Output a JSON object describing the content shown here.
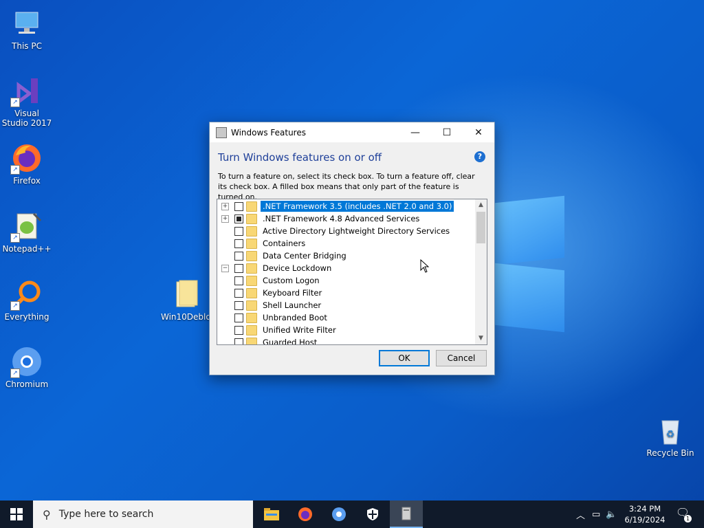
{
  "desktop": {
    "icons": [
      {
        "label": "This PC",
        "icon": "computer-icon"
      },
      {
        "label": "Visual Studio 2017",
        "icon": "visual-studio-icon"
      },
      {
        "label": "Firefox",
        "icon": "firefox-icon"
      },
      {
        "label": "Notepad++",
        "icon": "notepadpp-icon"
      },
      {
        "label": "Everything",
        "icon": "everything-search-icon"
      },
      {
        "label": "Chromium",
        "icon": "chromium-icon"
      },
      {
        "label": "Win10Deblo...",
        "icon": "folder-icon"
      },
      {
        "label": "Recycle Bin",
        "icon": "recycle-bin-icon"
      }
    ]
  },
  "dialog": {
    "title": "Windows Features",
    "heading": "Turn Windows features on or off",
    "description": "To turn a feature on, select its check box. To turn a feature off, clear its check box. A filled box means that only part of the feature is turned on.",
    "features": [
      {
        "label": ".NET Framework 3.5 (includes .NET 2.0 and 3.0)",
        "state": "unchecked",
        "expander": "+",
        "level": 0,
        "selected": true
      },
      {
        "label": ".NET Framework 4.8 Advanced Services",
        "state": "partial",
        "expander": "+",
        "level": 0,
        "selected": false
      },
      {
        "label": "Active Directory Lightweight Directory Services",
        "state": "unchecked",
        "expander": "",
        "level": 0,
        "selected": false
      },
      {
        "label": "Containers",
        "state": "unchecked",
        "expander": "",
        "level": 0,
        "selected": false
      },
      {
        "label": "Data Center Bridging",
        "state": "unchecked",
        "expander": "",
        "level": 0,
        "selected": false
      },
      {
        "label": "Device Lockdown",
        "state": "unchecked",
        "expander": "−",
        "level": 0,
        "selected": false
      },
      {
        "label": "Custom Logon",
        "state": "unchecked",
        "expander": "",
        "level": 1,
        "selected": false
      },
      {
        "label": "Keyboard Filter",
        "state": "unchecked",
        "expander": "",
        "level": 1,
        "selected": false
      },
      {
        "label": "Shell Launcher",
        "state": "unchecked",
        "expander": "",
        "level": 1,
        "selected": false
      },
      {
        "label": "Unbranded Boot",
        "state": "unchecked",
        "expander": "",
        "level": 1,
        "selected": false
      },
      {
        "label": "Unified Write Filter",
        "state": "unchecked",
        "expander": "",
        "level": 1,
        "selected": false
      },
      {
        "label": "Guarded Host",
        "state": "unchecked",
        "expander": "",
        "level": 0,
        "selected": false
      }
    ],
    "ok_label": "OK",
    "cancel_label": "Cancel",
    "help_glyph": "?"
  },
  "taskbar": {
    "search_placeholder": "Type here to search",
    "apps": [
      "file-explorer-icon",
      "firefox-icon",
      "chromium-icon",
      "windows-security-icon",
      "windows-features-icon"
    ],
    "time": "3:24 PM",
    "date": "6/19/2024",
    "notification_count": "1"
  },
  "colors": {
    "selection": "#0078d7",
    "heading": "#1e3f99",
    "taskbar": "#101a2a"
  }
}
